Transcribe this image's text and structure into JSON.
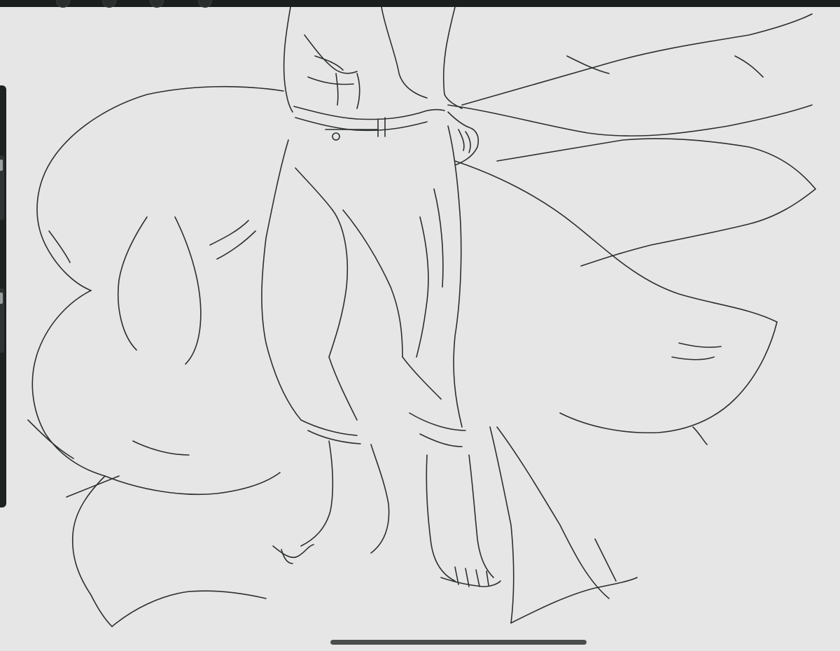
{
  "app": {
    "canvas_background": "#e6e6e6",
    "line_color": "#2b2f2e",
    "toolbar_color": "#1b1f1e",
    "side_panel_color": "#1e2322"
  },
  "toolbar": {
    "items": [
      "brush-tool-icon",
      "smudge-tool-icon",
      "eraser-tool-icon",
      "layers-icon"
    ]
  },
  "side_panel": {
    "controls": [
      "brush-size-slider",
      "brush-opacity-slider"
    ]
  },
  "canvas": {
    "subject": "line art sketch"
  }
}
